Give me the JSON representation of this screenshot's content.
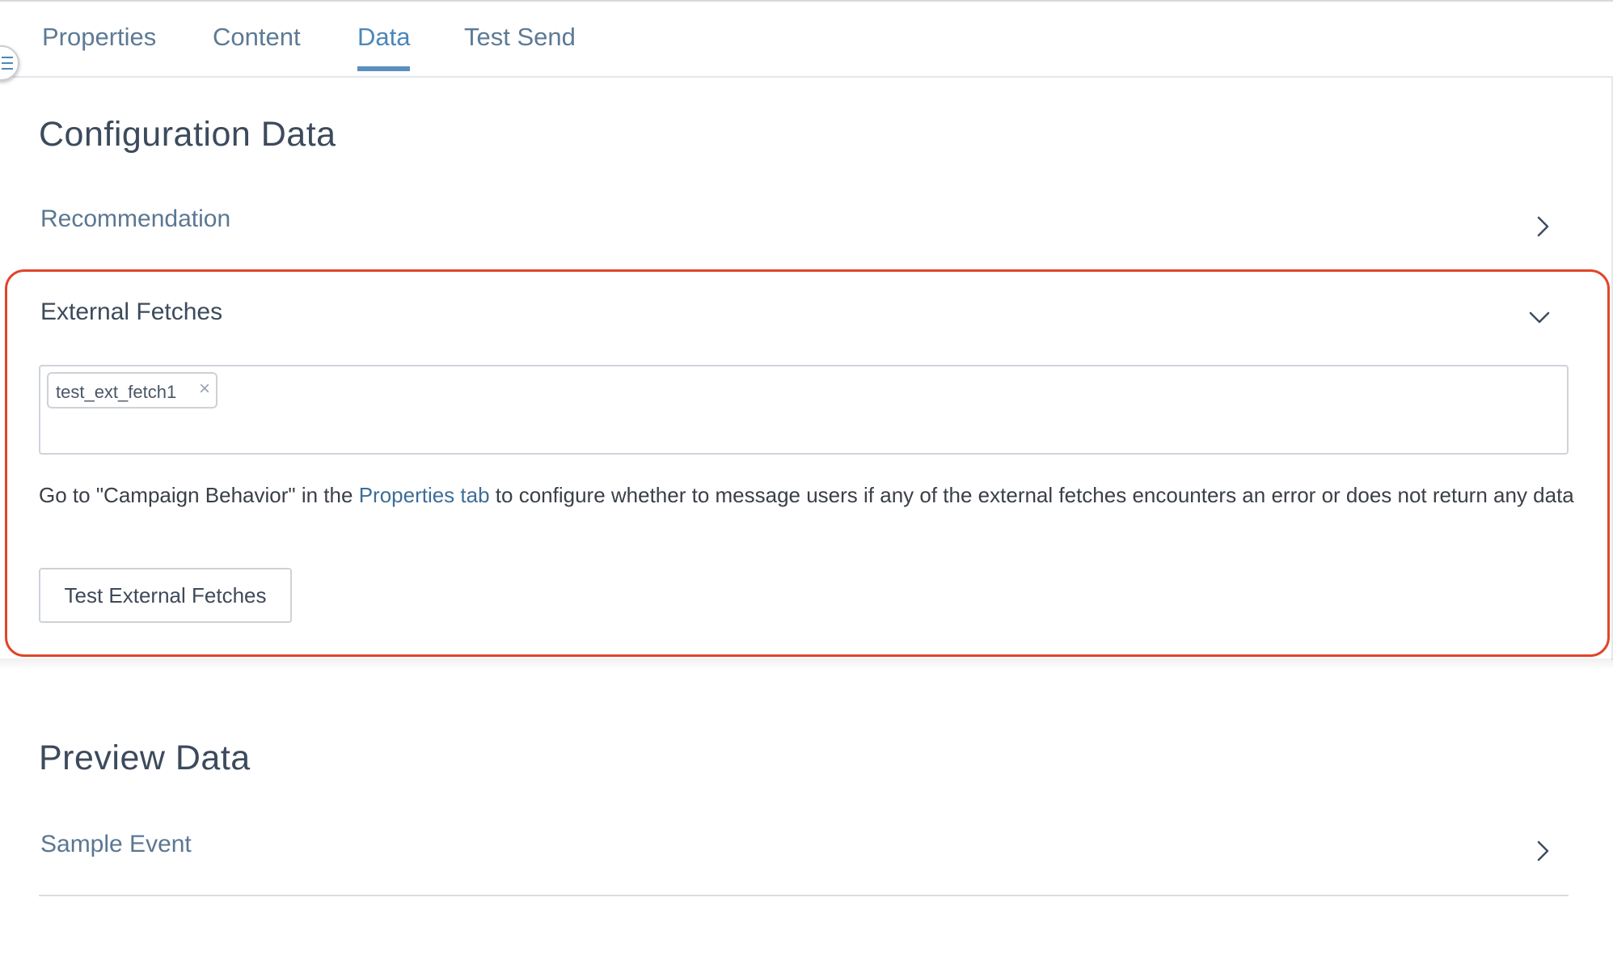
{
  "tabs": [
    {
      "label": "Properties"
    },
    {
      "label": "Content"
    },
    {
      "label": "Data"
    },
    {
      "label": "Test Send"
    }
  ],
  "active_tab": "Data",
  "configuration": {
    "title": "Configuration Data",
    "recommendation_label": "Recommendation"
  },
  "external_fetches": {
    "title": "External Fetches",
    "tags": [
      "test_ext_fetch1"
    ],
    "tag_remove_glyph": "×",
    "info_prefix": "Go to \"Campaign Behavior\" in the ",
    "info_link": "Properties tab",
    "info_suffix": " to configure whether to message users if any of the external fetches encounters an error or does not return any data",
    "test_button_label": "Test External Fetches"
  },
  "preview": {
    "title": "Preview Data",
    "sample_event_label": "Sample Event"
  },
  "colors": {
    "highlight": "#e0452b",
    "active_tab": "#4b87b8",
    "link": "#3d6d98"
  },
  "icons": [
    "menu-icon",
    "chevron-right-icon",
    "chevron-down-icon",
    "close-icon"
  ]
}
